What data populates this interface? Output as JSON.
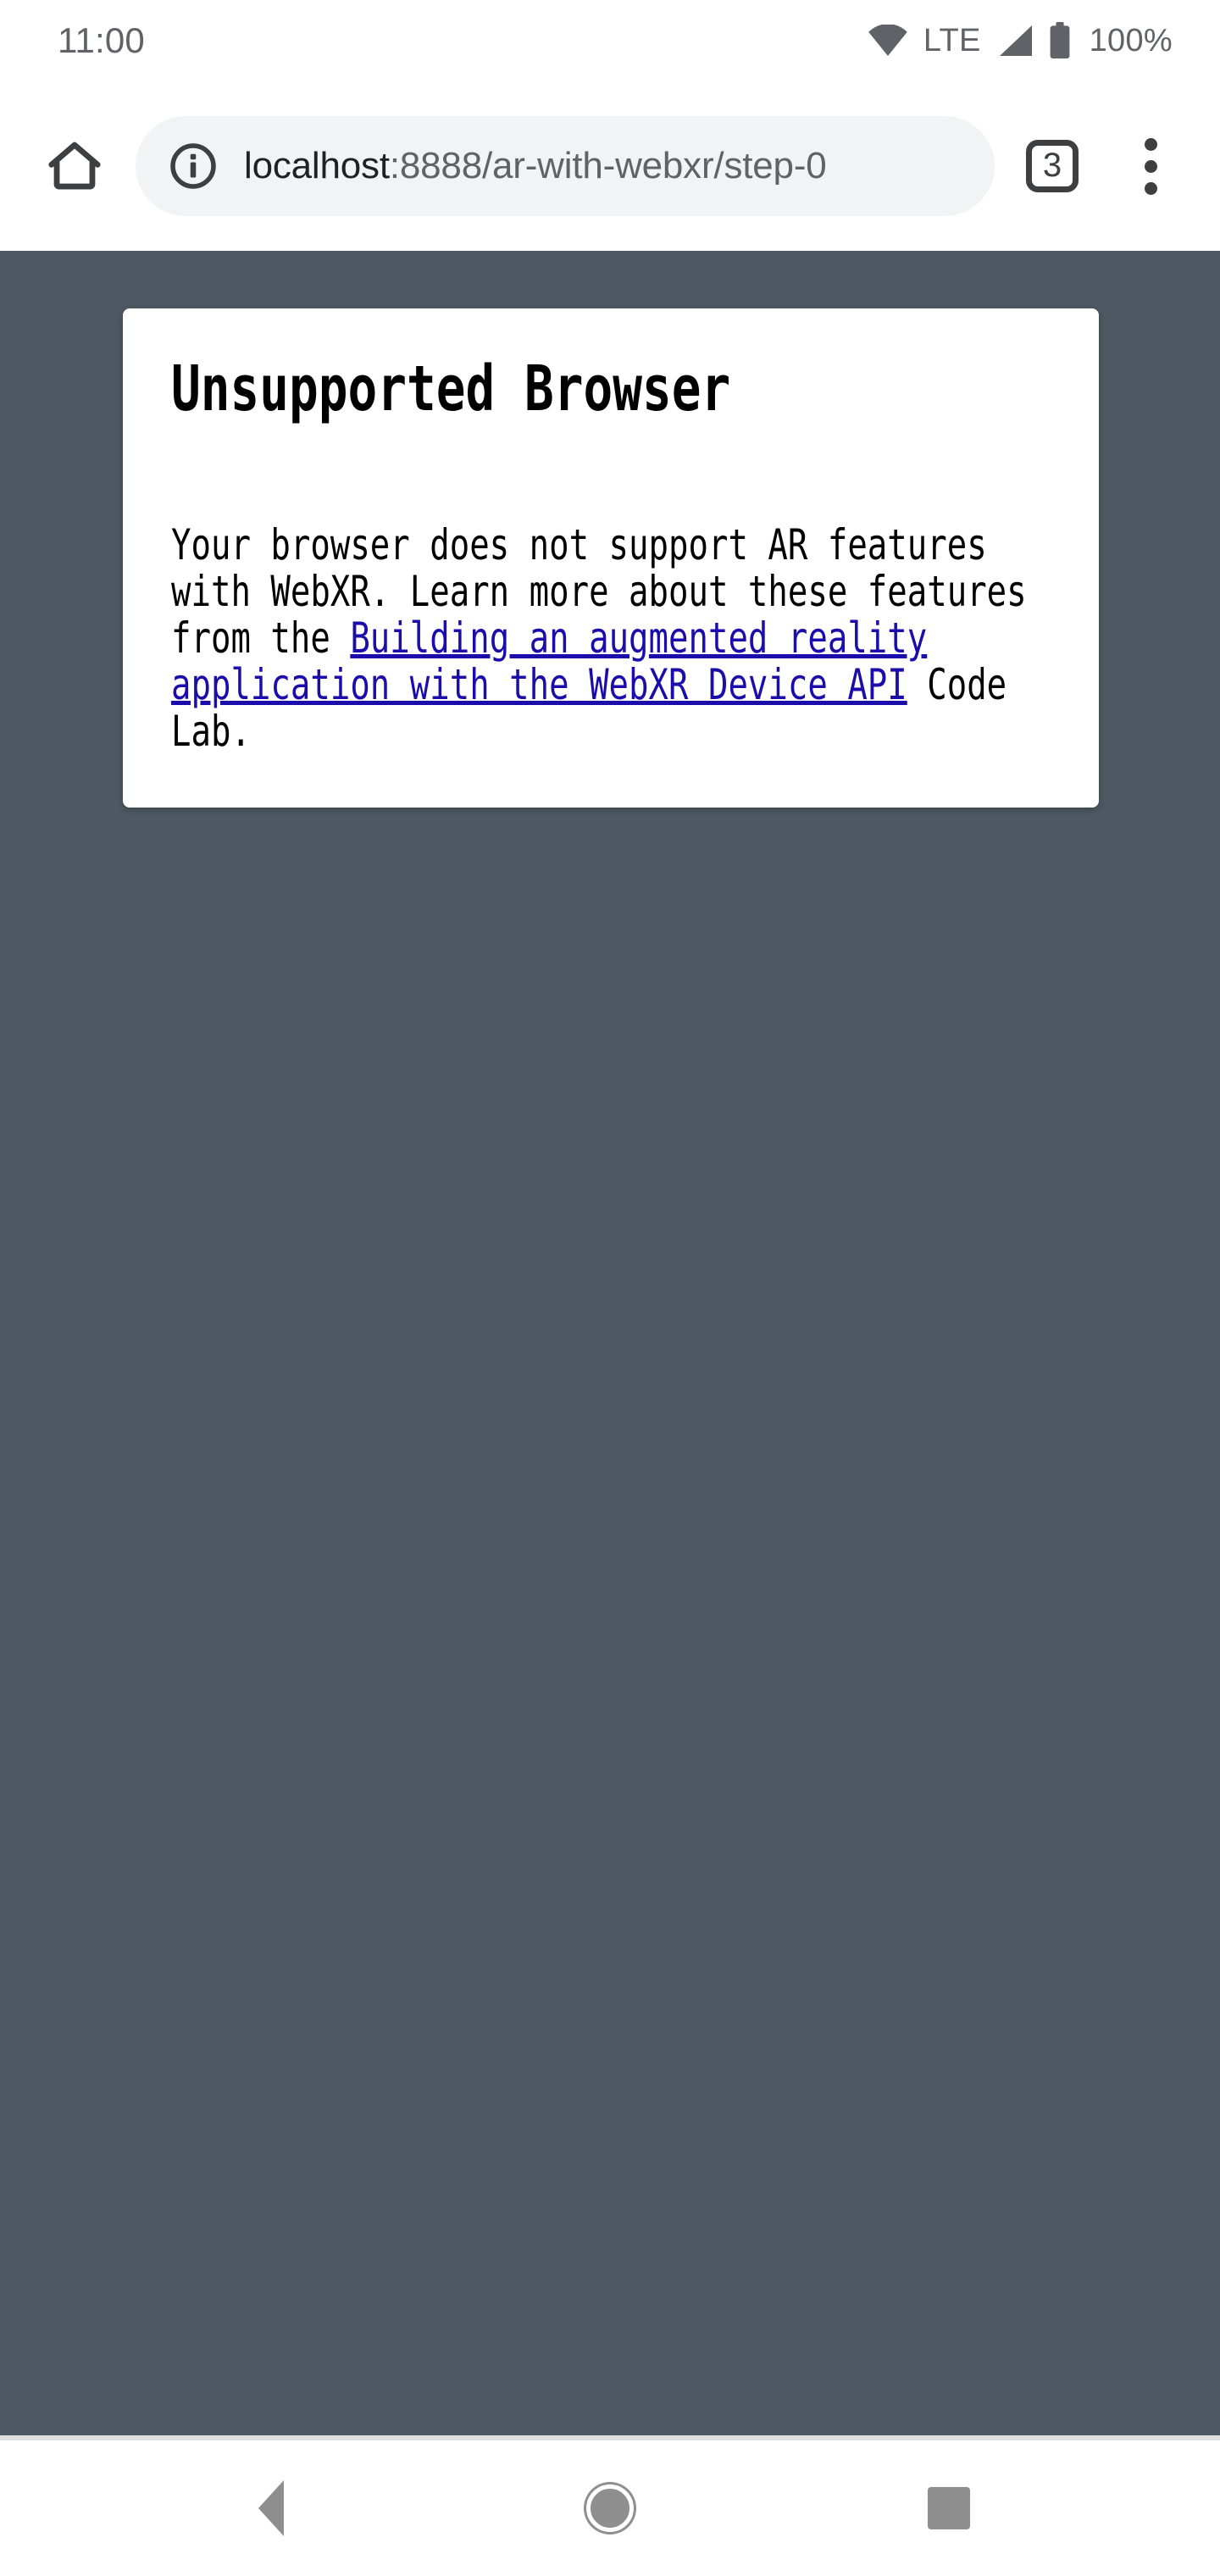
{
  "status_bar": {
    "time": "11:00",
    "network_label": "LTE",
    "battery_label": "100%",
    "wifi_icon": "wifi-icon",
    "signal_icon": "cell-signal-icon",
    "battery_icon": "battery-full-icon"
  },
  "toolbar": {
    "home_icon": "home-icon",
    "info_icon": "page-info-icon",
    "url_host": "localhost",
    "url_path": ":8888/ar-with-webxr/step-0",
    "url_full": "localhost:8888/ar-with-webxr/step-0",
    "tab_count": "3",
    "menu_icon": "overflow-menu-icon"
  },
  "page": {
    "background_color": "#4d5862",
    "card": {
      "title": "Unsupported Browser",
      "body_before_link": "Your browser does not support AR features with WebXR. Learn more about these features from the ",
      "link_text": "Building an augmented reality application with the WebXR Device API",
      "body_after_link": " Code Lab.",
      "link_color": "#1a0dab"
    }
  },
  "navbar": {
    "back_label": "back-button",
    "home_label": "home-button",
    "recents_label": "recents-button"
  }
}
